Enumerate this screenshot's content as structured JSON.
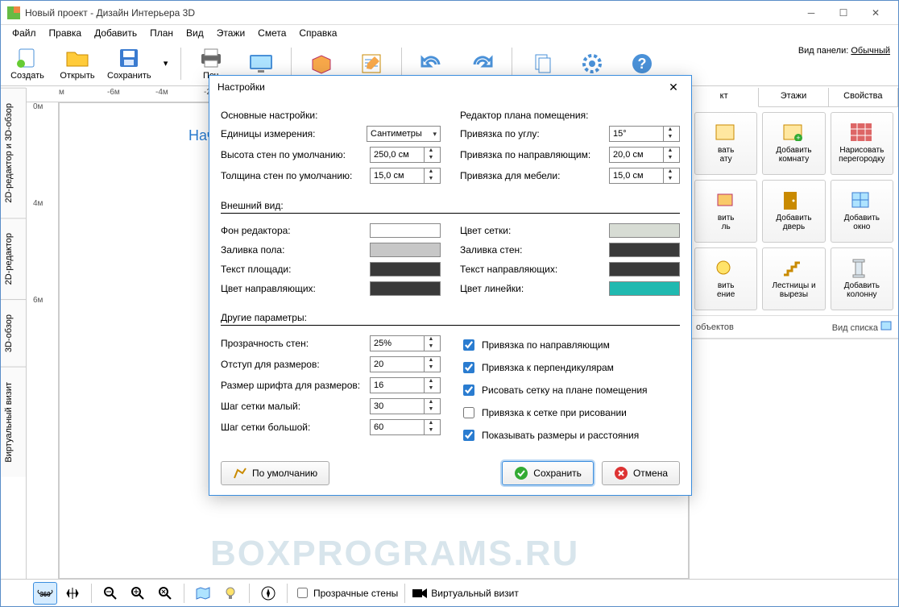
{
  "window": {
    "title": "Новый проект - Дизайн Интерьера 3D"
  },
  "menubar": [
    "Файл",
    "Правка",
    "Добавить",
    "План",
    "Вид",
    "Этажи",
    "Смета",
    "Справка"
  ],
  "toolbar": {
    "create": "Создать",
    "open": "Открыть",
    "save": "Сохранить",
    "print": "Печ",
    "view_panel_label": "Вид панели:",
    "view_panel_value": "Обычный"
  },
  "vtabs": [
    "2D-редактор и 3D-обзор",
    "2D-редактор",
    "3D-обзор",
    "Виртуальный визит"
  ],
  "ruler_x": [
    "м",
    "-6м",
    "-4м",
    "-2м"
  ],
  "ruler_y": [
    "0м",
    "",
    "4м",
    "",
    "6м"
  ],
  "canvas_hint": "Нач",
  "right_tabs": [
    "кт",
    "Этажи",
    "Свойства"
  ],
  "right_buttons": [
    {
      "l1": "вать",
      "l2": "ату"
    },
    {
      "l1": "Добавить",
      "l2": "комнату"
    },
    {
      "l1": "Нарисовать",
      "l2": "перегородку"
    },
    {
      "l1": "вить",
      "l2": "ль"
    },
    {
      "l1": "Добавить",
      "l2": "дверь"
    },
    {
      "l1": "Добавить",
      "l2": "окно"
    },
    {
      "l1": "вить",
      "l2": "ение"
    },
    {
      "l1": "Лестницы и",
      "l2": "вырезы"
    },
    {
      "l1": "Добавить",
      "l2": "колонну"
    }
  ],
  "right_caption": "объектов",
  "right_list_mode": "Вид списка",
  "bottom": {
    "check1": "Прозрачные стены",
    "check2": "Виртуальный визит"
  },
  "modal": {
    "title": "Настройки",
    "sec_basic": "Основные настройки:",
    "sec_editor": "Редактор плана помещения:",
    "sec_appearance": "Внешний вид:",
    "sec_other": "Другие параметры:",
    "units_label": "Единицы измерения:",
    "units_value": "Сантиметры",
    "wallh_label": "Высота стен по умолчанию:",
    "wallh_value": "250,0 см",
    "wallt_label": "Толщина стен по умолчанию:",
    "wallt_value": "15,0 см",
    "snap_angle_label": "Привязка по углу:",
    "snap_angle_value": "15°",
    "snap_guide_label": "Привязка по направляющим:",
    "snap_guide_value": "20,0 см",
    "snap_furn_label": "Привязка для мебели:",
    "snap_furn_value": "15,0 см",
    "bg_label": "Фон редактора:",
    "bg_color": "#ffffff",
    "grid_color_label": "Цвет сетки:",
    "grid_color": "#d7dcd4",
    "floor_label": "Заливка пола:",
    "floor_color": "#c7c7c7",
    "wall_fill_label": "Заливка стен:",
    "wall_fill": "#3a3a3a",
    "area_text_label": "Текст площади:",
    "area_text_color": "#3a3a3a",
    "guide_text_label": "Текст направляющих:",
    "guide_text_color": "#3a3a3a",
    "guide_color_label": "Цвет направляющих:",
    "guide_color": "#3a3a3a",
    "ruler_color_label": "Цвет линейки:",
    "ruler_color": "#20b9b0",
    "opacity_label": "Прозрачность стен:",
    "opacity_value": "25%",
    "offset_label": "Отступ для размеров:",
    "offset_value": "20",
    "fontsize_label": "Размер шрифта для размеров:",
    "fontsize_value": "16",
    "grid_small_label": "Шаг сетки малый:",
    "grid_small_value": "30",
    "grid_big_label": "Шаг сетки большой:",
    "grid_big_value": "60",
    "chk_guides": "Привязка по направляющим",
    "chk_perp": "Привязка к перпендикулярам",
    "chk_grid_draw": "Рисовать сетку на плане помещения",
    "chk_grid_snap": "Привязка к сетке при рисовании",
    "chk_dims": "Показывать размеры и расстояния",
    "btn_default": "По умолчанию",
    "btn_save": "Сохранить",
    "btn_cancel": "Отмена"
  },
  "watermark": "BOXPROGRAMS.RU"
}
